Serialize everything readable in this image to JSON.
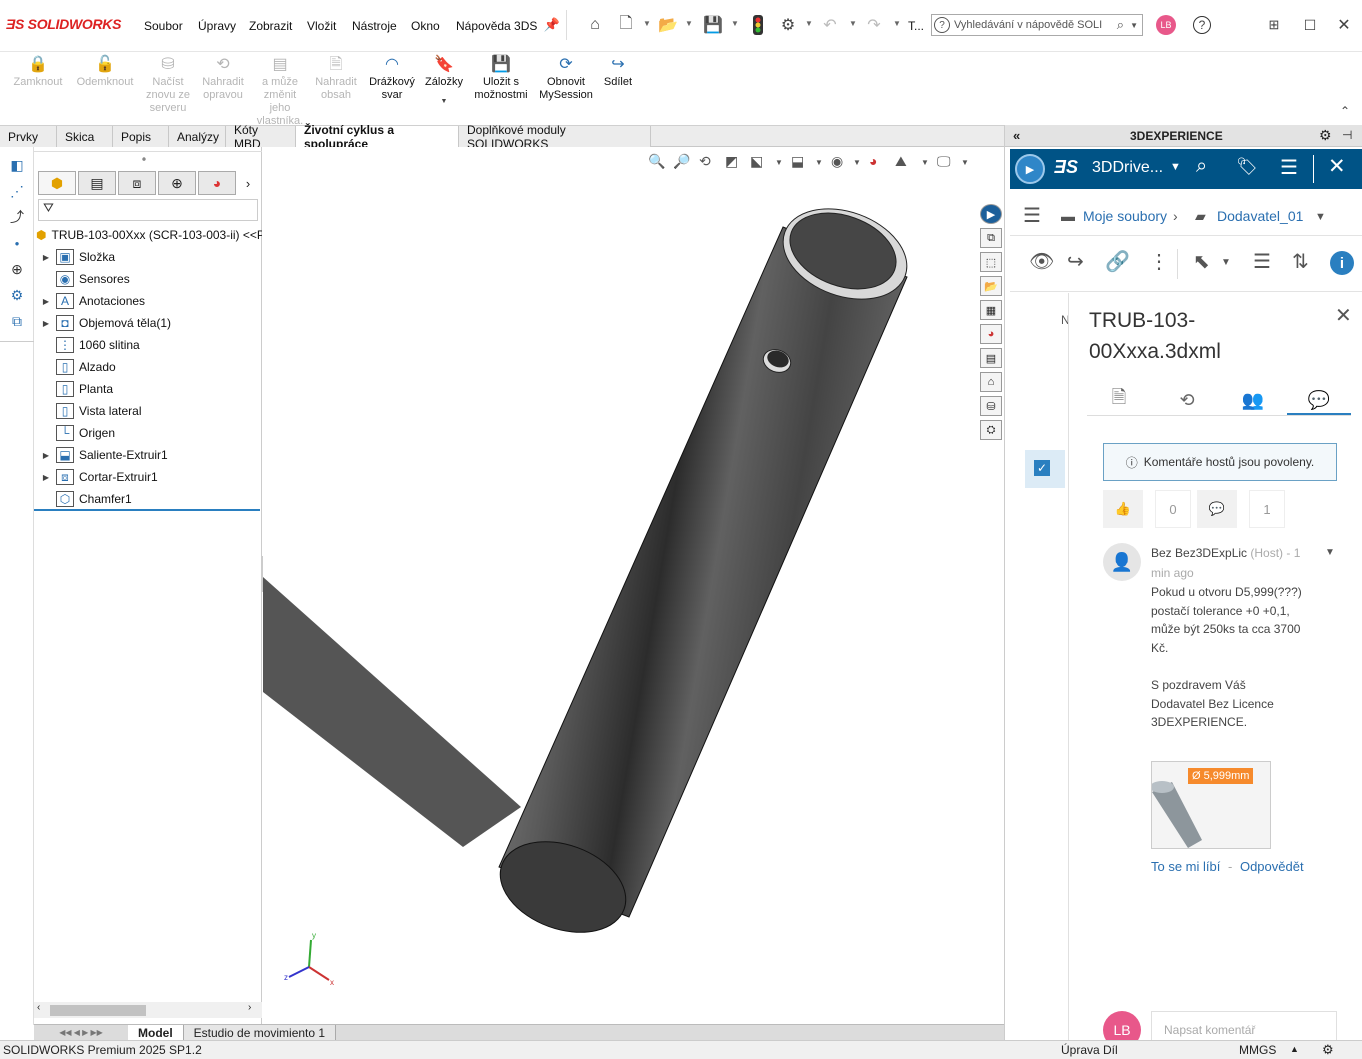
{
  "app": {
    "logo_brand": "SOLIDWORKS"
  },
  "menu": [
    "Soubor",
    "Úpravy",
    "Zobrazit",
    "Vložit",
    "Nástroje",
    "Okno",
    "Nápověda 3DS"
  ],
  "toolbar": {
    "truncated_label": "T..."
  },
  "help_search": {
    "placeholder": "Vyhledávání v nápovědě SOLI"
  },
  "user": {
    "initials": "LB"
  },
  "ribbon": [
    {
      "label": "Zamknout",
      "enabled": false,
      "icon": "lock-icon"
    },
    {
      "label": "Odemknout",
      "enabled": false,
      "icon": "unlock-icon"
    },
    {
      "label": "Načíst znovu ze serveru",
      "enabled": false,
      "icon": "reload-icon"
    },
    {
      "label": "Nahradit opravou",
      "enabled": false,
      "icon": "replace-icon"
    },
    {
      "label": "a může změnit jeho vlastníka.",
      "enabled": false,
      "icon": "owner-icon"
    },
    {
      "label": "Nahradit obsah",
      "enabled": false,
      "icon": "replace-content-icon"
    },
    {
      "label": "Drážkový svar",
      "enabled": true,
      "icon": "weld-icon"
    },
    {
      "label": "Záložky",
      "enabled": true,
      "icon": "bookmark-icon"
    },
    {
      "label": "Uložit s možnostmi",
      "enabled": true,
      "icon": "save-options-icon"
    },
    {
      "label": "Obnovit MySession",
      "enabled": true,
      "icon": "refresh-icon"
    },
    {
      "label": "Sdílet",
      "enabled": true,
      "icon": "share-icon"
    }
  ],
  "tabs": [
    {
      "label": "Prvky",
      "active": false
    },
    {
      "label": "Skica",
      "active": false
    },
    {
      "label": "Popis",
      "active": false
    },
    {
      "label": "Analýzy",
      "active": false
    },
    {
      "label": "Kóty MBD",
      "active": false
    },
    {
      "label": "Životní cyklus a spolupráce",
      "active": true
    },
    {
      "label": "Doplňkové moduly SOLIDWORKS",
      "active": false
    }
  ],
  "feature_tree": {
    "root": "TRUB-103-00Xxx (SCR-103-003-ii) <<P",
    "items": [
      {
        "label": "Složka",
        "expandable": true,
        "icon": "folder-icon"
      },
      {
        "label": "Sensores",
        "expandable": false,
        "icon": "sensor-icon"
      },
      {
        "label": "Anotaciones",
        "expandable": true,
        "icon": "annotation-icon"
      },
      {
        "label": "Objemová těla(1)",
        "expandable": true,
        "icon": "solid-bodies-icon"
      },
      {
        "label": "1060 slitina",
        "expandable": false,
        "icon": "material-icon"
      },
      {
        "label": "Alzado",
        "expandable": false,
        "icon": "plane-icon"
      },
      {
        "label": "Planta",
        "expandable": false,
        "icon": "plane-icon"
      },
      {
        "label": "Vista lateral",
        "expandable": false,
        "icon": "plane-icon"
      },
      {
        "label": "Origen",
        "expandable": false,
        "icon": "origin-icon"
      },
      {
        "label": "Saliente-Extruir1",
        "expandable": true,
        "icon": "extrude-icon"
      },
      {
        "label": "Cortar-Extruir1",
        "expandable": true,
        "icon": "cut-extrude-icon"
      },
      {
        "label": "Chamfer1",
        "expandable": false,
        "icon": "chamfer-icon"
      }
    ]
  },
  "bottom_tabs": [
    {
      "label": "Model",
      "selected": true
    },
    {
      "label": "Estudio de movimiento 1",
      "selected": false
    }
  ],
  "status": {
    "product": "SOLIDWORKS Premium 2025 SP1.2",
    "mode": "Úprava Díl",
    "units": "MMGS"
  },
  "triad": {
    "x": "x",
    "y": "y",
    "z": "z"
  },
  "dx": {
    "header": "3DEXPERIENCE",
    "app_title": "3DDrive...",
    "breadcrumb": {
      "root": "Moje soubory",
      "folder": "Dodavatel_01"
    },
    "detail": {
      "title": "TRUB-103-00Xxxa.3dxml",
      "info": "Komentáře hostů jsou povoleny.",
      "likes": "0",
      "comments": "1",
      "comment": {
        "author": "Bez Bez3DExpLic",
        "role": "(Host) - 1 min ago",
        "text_lines": [
          "Pokud u otvoru D5,999(???)",
          "postačí tolerance +0 +0,1,",
          "může být 250ks ta cca 3700",
          "Kč.",
          "",
          "S pozdravem Váš",
          "Dodavatel Bez Licence",
          "3DEXPERIENCE."
        ],
        "image_badge": "Ø 5,999mm",
        "like_action": "To se mi líbí",
        "reply_action": "Odpovědět"
      },
      "input_placeholder": "Napsat komentář"
    }
  },
  "colors": {
    "accent": "#2a6fb0",
    "dx_blue": "#005386",
    "avatar": "#e8588a",
    "badge": "#f68a2c"
  }
}
